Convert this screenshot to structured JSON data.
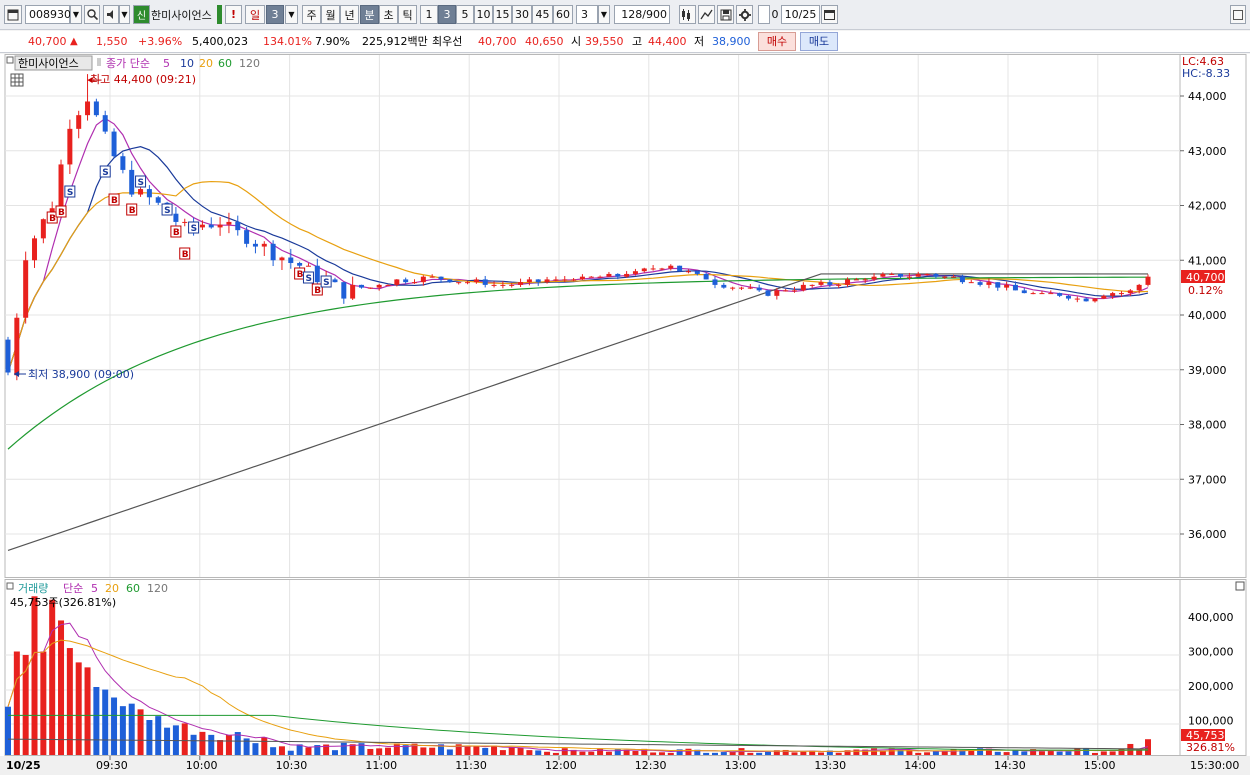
{
  "toolbar": {
    "code": "008930",
    "search_badge": "신",
    "name": "한미사이언스",
    "alert": "!",
    "period_day": "일",
    "period_day_count": "3",
    "period_week": "주",
    "period_month": "월",
    "period_year": "년",
    "period_minute": "분",
    "period_second": "초",
    "period_tick": "틱",
    "intervals": [
      "1",
      "3",
      "5",
      "10",
      "15",
      "30",
      "45",
      "60"
    ],
    "interval_input": "3",
    "count": "128",
    "count_total": "/900",
    "date": "10/25"
  },
  "quote": {
    "price": "40,700",
    "arrow": "▲",
    "change": "1,550",
    "rate": "+3.96%",
    "volume": "5,400,023",
    "volume_ratio": "134.01%",
    "turnover": "7.90%",
    "amount": "225,912백만",
    "priority_label": "최우선",
    "ask": "40,700",
    "bid": "40,650",
    "open_label": "시",
    "open": "39,550",
    "high_label": "고",
    "high": "44,400",
    "low_label": "저",
    "low": "38,900",
    "buy": "매수",
    "sell": "매도"
  },
  "price_panel": {
    "name_tag": "한미사이언스",
    "ma_label": "종가 단순",
    "ma_periods": [
      "5",
      "10",
      "20",
      "60",
      "120"
    ],
    "high_note": "최고 44,400 (09:21)",
    "low_note": "최저 38,900 (09:00)",
    "lc": "LC:4.63",
    "hc": "HC:-8.33",
    "y_ticks": [
      "44,000",
      "43,000",
      "42,000",
      "41,000",
      "40,000",
      "39,000",
      "38,000",
      "37,000",
      "36,000"
    ],
    "current": "40,700",
    "current_pct": "0.12%"
  },
  "volume_panel": {
    "title": "거래량",
    "ma_label": "단순",
    "ma_periods": [
      "5",
      "20",
      "60",
      "120"
    ],
    "info": "45,753주(326.81%)",
    "y_ticks": [
      "400,000",
      "300,000",
      "200,000",
      "100,000"
    ],
    "current": "45,753",
    "current_pct": "326.81%"
  },
  "x_axis": {
    "date": "10/25",
    "times": [
      "09:30",
      "10:00",
      "10:30",
      "11:00",
      "11:30",
      "12:00",
      "12:30",
      "13:00",
      "13:30",
      "14:00",
      "14:30",
      "15:00"
    ],
    "end": "15:30:00"
  },
  "colors": {
    "up": "#e8211e",
    "down": "#1e5fd8",
    "ma5": "#b02fb0",
    "ma10": "#1a3a9a",
    "ma20": "#e8a010",
    "ma60": "#1f9a30",
    "ma120": "#555555"
  },
  "chart_data": {
    "type": "candlestick",
    "title": "한미사이언스",
    "interval": "3분",
    "x_range": [
      "09:00",
      "15:30"
    ],
    "y_range": [
      35500,
      44800
    ],
    "open": 39550,
    "high": 44400,
    "low": 38900,
    "close": 40700,
    "volume_last": 45753
  }
}
